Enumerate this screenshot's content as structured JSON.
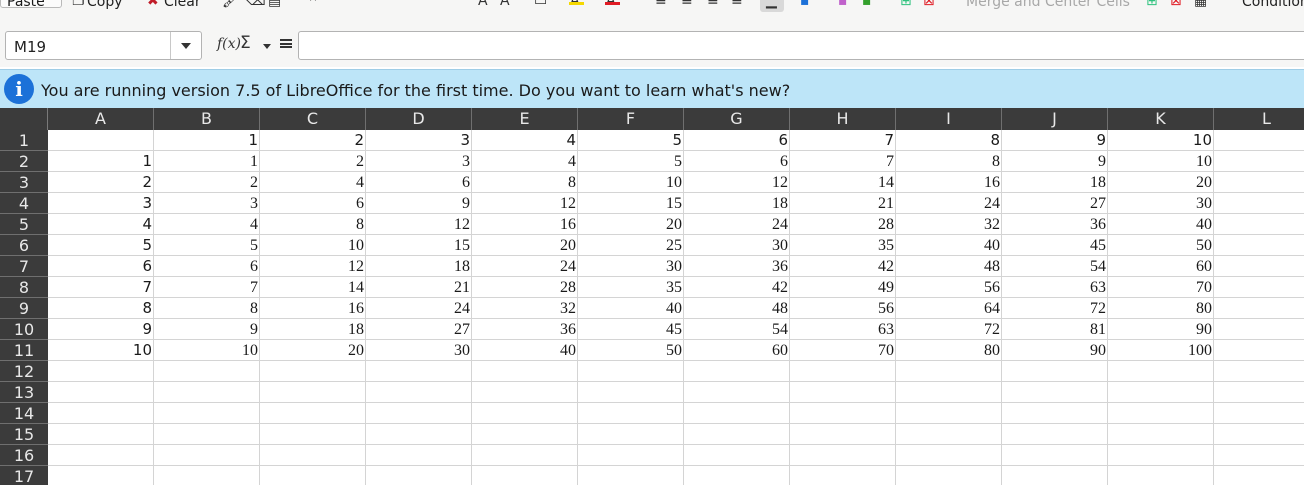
{
  "toolbar": {
    "paste_label": "Paste",
    "copy_label": "Copy",
    "clear_label": "Clear",
    "merge_label": "Merge and Center Cells",
    "conditional_label": "Conditional",
    "colors": {
      "highlight": "#f5d800",
      "font": "#e01b24"
    }
  },
  "formula_bar": {
    "cell_ref": "M19",
    "formula": ""
  },
  "infobar": {
    "message": "You are running version 7.5 of LibreOffice for the first time. Do you want to learn what's new?"
  },
  "sheet": {
    "columns": [
      "A",
      "B",
      "C",
      "D",
      "E",
      "F",
      "G",
      "H",
      "I",
      "J",
      "K",
      "L"
    ],
    "rows": [
      "1",
      "2",
      "3",
      "4",
      "5",
      "6",
      "7",
      "8",
      "9",
      "10",
      "11",
      "12",
      "13",
      "14",
      "15",
      "16",
      "17"
    ],
    "cells": [
      [
        "",
        "1",
        "2",
        "3",
        "4",
        "5",
        "6",
        "7",
        "8",
        "9",
        "10",
        ""
      ],
      [
        "1",
        "1",
        "2",
        "3",
        "4",
        "5",
        "6",
        "7",
        "8",
        "9",
        "10",
        ""
      ],
      [
        "2",
        "2",
        "4",
        "6",
        "8",
        "10",
        "12",
        "14",
        "16",
        "18",
        "20",
        ""
      ],
      [
        "3",
        "3",
        "6",
        "9",
        "12",
        "15",
        "18",
        "21",
        "24",
        "27",
        "30",
        ""
      ],
      [
        "4",
        "4",
        "8",
        "12",
        "16",
        "20",
        "24",
        "28",
        "32",
        "36",
        "40",
        ""
      ],
      [
        "5",
        "5",
        "10",
        "15",
        "20",
        "25",
        "30",
        "35",
        "40",
        "45",
        "50",
        ""
      ],
      [
        "6",
        "6",
        "12",
        "18",
        "24",
        "30",
        "36",
        "42",
        "48",
        "54",
        "60",
        ""
      ],
      [
        "7",
        "7",
        "14",
        "21",
        "28",
        "35",
        "42",
        "49",
        "56",
        "63",
        "70",
        ""
      ],
      [
        "8",
        "8",
        "16",
        "24",
        "32",
        "40",
        "48",
        "56",
        "64",
        "72",
        "80",
        ""
      ],
      [
        "9",
        "9",
        "18",
        "27",
        "36",
        "45",
        "54",
        "63",
        "72",
        "81",
        "90",
        ""
      ],
      [
        "10",
        "10",
        "20",
        "30",
        "40",
        "50",
        "60",
        "70",
        "80",
        "90",
        "100",
        ""
      ],
      [
        "",
        "",
        "",
        "",
        "",
        "",
        "",
        "",
        "",
        "",
        "",
        ""
      ],
      [
        "",
        "",
        "",
        "",
        "",
        "",
        "",
        "",
        "",
        "",
        "",
        ""
      ],
      [
        "",
        "",
        "",
        "",
        "",
        "",
        "",
        "",
        "",
        "",
        "",
        ""
      ],
      [
        "",
        "",
        "",
        "",
        "",
        "",
        "",
        "",
        "",
        "",
        "",
        ""
      ],
      [
        "",
        "",
        "",
        "",
        "",
        "",
        "",
        "",
        "",
        "",
        "",
        ""
      ],
      [
        "",
        "",
        "",
        "",
        "",
        "",
        "",
        "",
        "",
        "",
        "",
        ""
      ]
    ]
  }
}
